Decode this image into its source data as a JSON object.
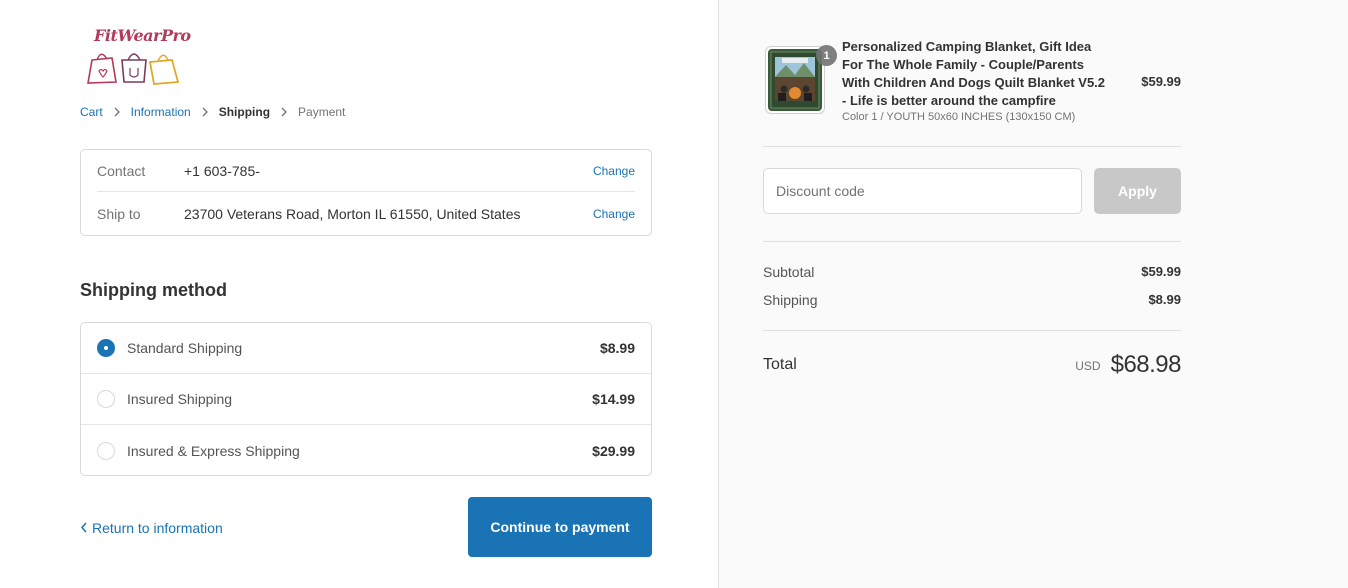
{
  "brand": {
    "logo_text": "FitWearPro"
  },
  "breadcrumb": {
    "cart": "Cart",
    "information": "Information",
    "shipping": "Shipping",
    "payment": "Payment"
  },
  "review": {
    "contact_label": "Contact",
    "contact_value": "+1 603-785-",
    "ship_label": "Ship to",
    "ship_value": "23700 Veterans Road, Morton IL 61550, United States",
    "change_label": "Change"
  },
  "shipping_method": {
    "title": "Shipping method",
    "options": [
      {
        "name": "Standard Shipping",
        "price": "$8.99",
        "selected": true
      },
      {
        "name": "Insured Shipping",
        "price": "$14.99",
        "selected": false
      },
      {
        "name": "Insured & Express Shipping",
        "price": "$29.99",
        "selected": false
      }
    ]
  },
  "actions": {
    "return_label": "Return to information",
    "continue_label": "Continue to payment"
  },
  "order": {
    "product": {
      "quantity": "1",
      "name": "Personalized Camping Blanket, Gift Idea For The Whole Family - Couple/Parents With Children And Dogs Quilt Blanket V5.2 - Life is better around the campfire",
      "variant": "Color 1 / YOUTH 50x60 INCHES (130x150 CM)",
      "price": "$59.99"
    },
    "discount": {
      "placeholder": "Discount code",
      "apply_label": "Apply"
    },
    "subtotal_label": "Subtotal",
    "subtotal_value": "$59.99",
    "shipping_label": "Shipping",
    "shipping_value": "$8.99",
    "total_label": "Total",
    "currency": "USD",
    "total_value": "$68.98"
  },
  "colors": {
    "accent": "#1a73b5",
    "brand": "#b33a5a",
    "apply_disabled": "#c8c8c8"
  }
}
